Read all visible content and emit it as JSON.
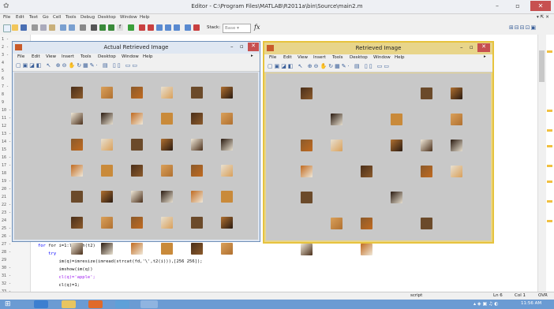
{
  "window": {
    "title": "Editor - C:\\Program Files\\MATLAB\\R2011a\\bin\\Source\\main2.m",
    "app_icon": "matlab-icon",
    "controls": [
      "–",
      "▫",
      "✕"
    ]
  },
  "menu": [
    "File",
    "Edit",
    "Text",
    "Go",
    "Cell",
    "Tools",
    "Debug",
    "Desktop",
    "Window",
    "Help"
  ],
  "toolbar": {
    "stack_label": "Stack:",
    "stack_value": "Base",
    "fx_label": "fx"
  },
  "line_numbers": [
    "1 -",
    "2 -",
    "3 -",
    "4",
    "5",
    "6",
    "7 -",
    "8",
    "9",
    "10 -",
    "11 -",
    "12",
    "13 -",
    "14 -",
    "15",
    "16 -",
    "17 -",
    "18",
    "19 -",
    "20 -",
    "21",
    "22 -",
    "23 -",
    "24",
    "25 -",
    "26 -",
    "27 -",
    "28 -",
    "29",
    "30 -",
    "31 -",
    "32 -",
    "33 -"
  ],
  "code": {
    "line28": "for i=1:length(t2)",
    "line29": "    try",
    "line30": "        im(q)=imresize(imread(strcat(fd,'\\',t2(i))),[256 256]);",
    "line31": "        imshow(im(q))",
    "line32": "        cl(q)='apple';",
    "line33": "        cl(q)=1;"
  },
  "status": {
    "mode": "script",
    "ln": "Ln  6",
    "col": "Col  1",
    "ovr": "OVR"
  },
  "figure_actual": {
    "title": "Actual Retrieved Image",
    "menu": [
      "File",
      "Edit",
      "View",
      "Insert",
      "Tools",
      "Desktop",
      "Window",
      "Help"
    ]
  },
  "figure_retrieved": {
    "title": "Retrieved Image",
    "menu": [
      "File",
      "Edit",
      "View",
      "Insert",
      "Tools",
      "Desktop",
      "Window",
      "Help"
    ]
  },
  "colors": {
    "lion_gold": "#c98a3a",
    "lion_dark": "#4a2f1a",
    "canvas": "#c8c8c8",
    "active_border": "#e7c33d",
    "close_red": "#c75050"
  },
  "taskbar": {
    "clock": "11:56 AM",
    "apps": [
      "start-icon",
      "ie-icon",
      "folder-icon",
      "media-icon",
      "paint-icon",
      "matlab-icon"
    ]
  }
}
